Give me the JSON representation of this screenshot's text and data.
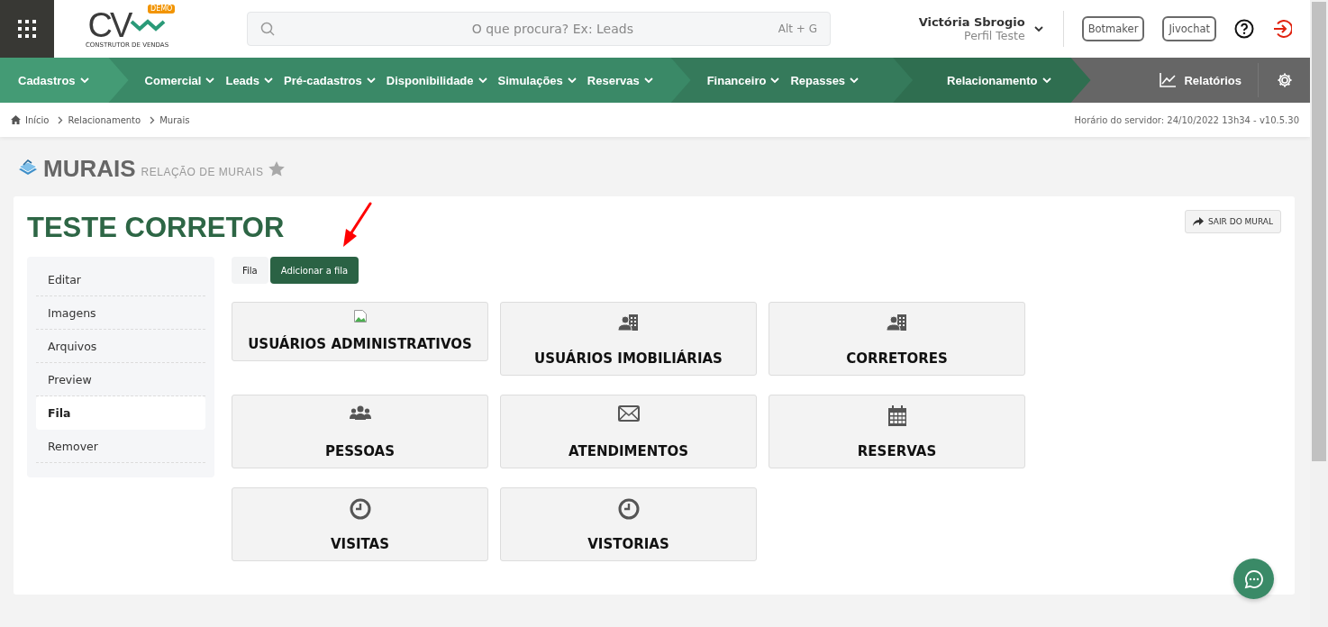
{
  "header": {
    "logo": {
      "mark": "CV",
      "badge": "DEMO",
      "tagline": "CONSTRUTOR DE VENDAS"
    },
    "search": {
      "placeholder": "O que procura? Ex: Leads",
      "shortcut": "Alt + G"
    },
    "user": {
      "name": "Victória Sbrogio",
      "profile": "Perfil Teste"
    },
    "buttons": [
      "Botmaker",
      "Jivochat"
    ]
  },
  "nav": {
    "groups": [
      {
        "items": [
          "Cadastros"
        ]
      },
      {
        "items": [
          "Comercial",
          "Leads",
          "Pré-cadastros",
          "Disponibilidade",
          "Simulações",
          "Reservas"
        ]
      },
      {
        "items": [
          "Financeiro",
          "Repasses"
        ]
      },
      {
        "items": [
          "Relacionamento"
        ]
      }
    ],
    "reports": "Relatórios"
  },
  "breadcrumb": {
    "items": [
      "Início",
      "Relacionamento",
      "Murais"
    ],
    "server_time": "Horário do servidor: 24/10/2022 13h34 - v10.5.30"
  },
  "page": {
    "title": "MURAIS",
    "subtitle": "RELAÇÃO DE MURAIS",
    "favorite": false
  },
  "mural": {
    "title": "TESTE CORRETOR",
    "exit_button": "SAIR DO MURAL",
    "sidebar": [
      {
        "label": "Editar",
        "selected": false
      },
      {
        "label": "Imagens",
        "selected": false
      },
      {
        "label": "Arquivos",
        "selected": false
      },
      {
        "label": "Preview",
        "selected": false
      },
      {
        "label": "Fila",
        "selected": true
      },
      {
        "label": "Remover",
        "selected": false
      }
    ],
    "tabs": [
      {
        "label": "Fila",
        "selected": false
      },
      {
        "label": "Adicionar a fila",
        "selected": true
      }
    ],
    "tiles": [
      {
        "label": "USUÁRIOS ADMINISTRATIVOS",
        "kind": "broken"
      },
      {
        "label": "USUÁRIOS IMOBILIÁRIAS",
        "kind": "agency"
      },
      {
        "label": "CORRETORES",
        "kind": "agency"
      },
      {
        "label": "PESSOAS",
        "kind": "people"
      },
      {
        "label": "ATENDIMENTOS",
        "kind": "message"
      },
      {
        "label": "RESERVAS",
        "kind": "booking"
      },
      {
        "label": "VISITAS",
        "kind": "schedule"
      },
      {
        "label": "VISTORIAS",
        "kind": "schedule"
      }
    ]
  }
}
